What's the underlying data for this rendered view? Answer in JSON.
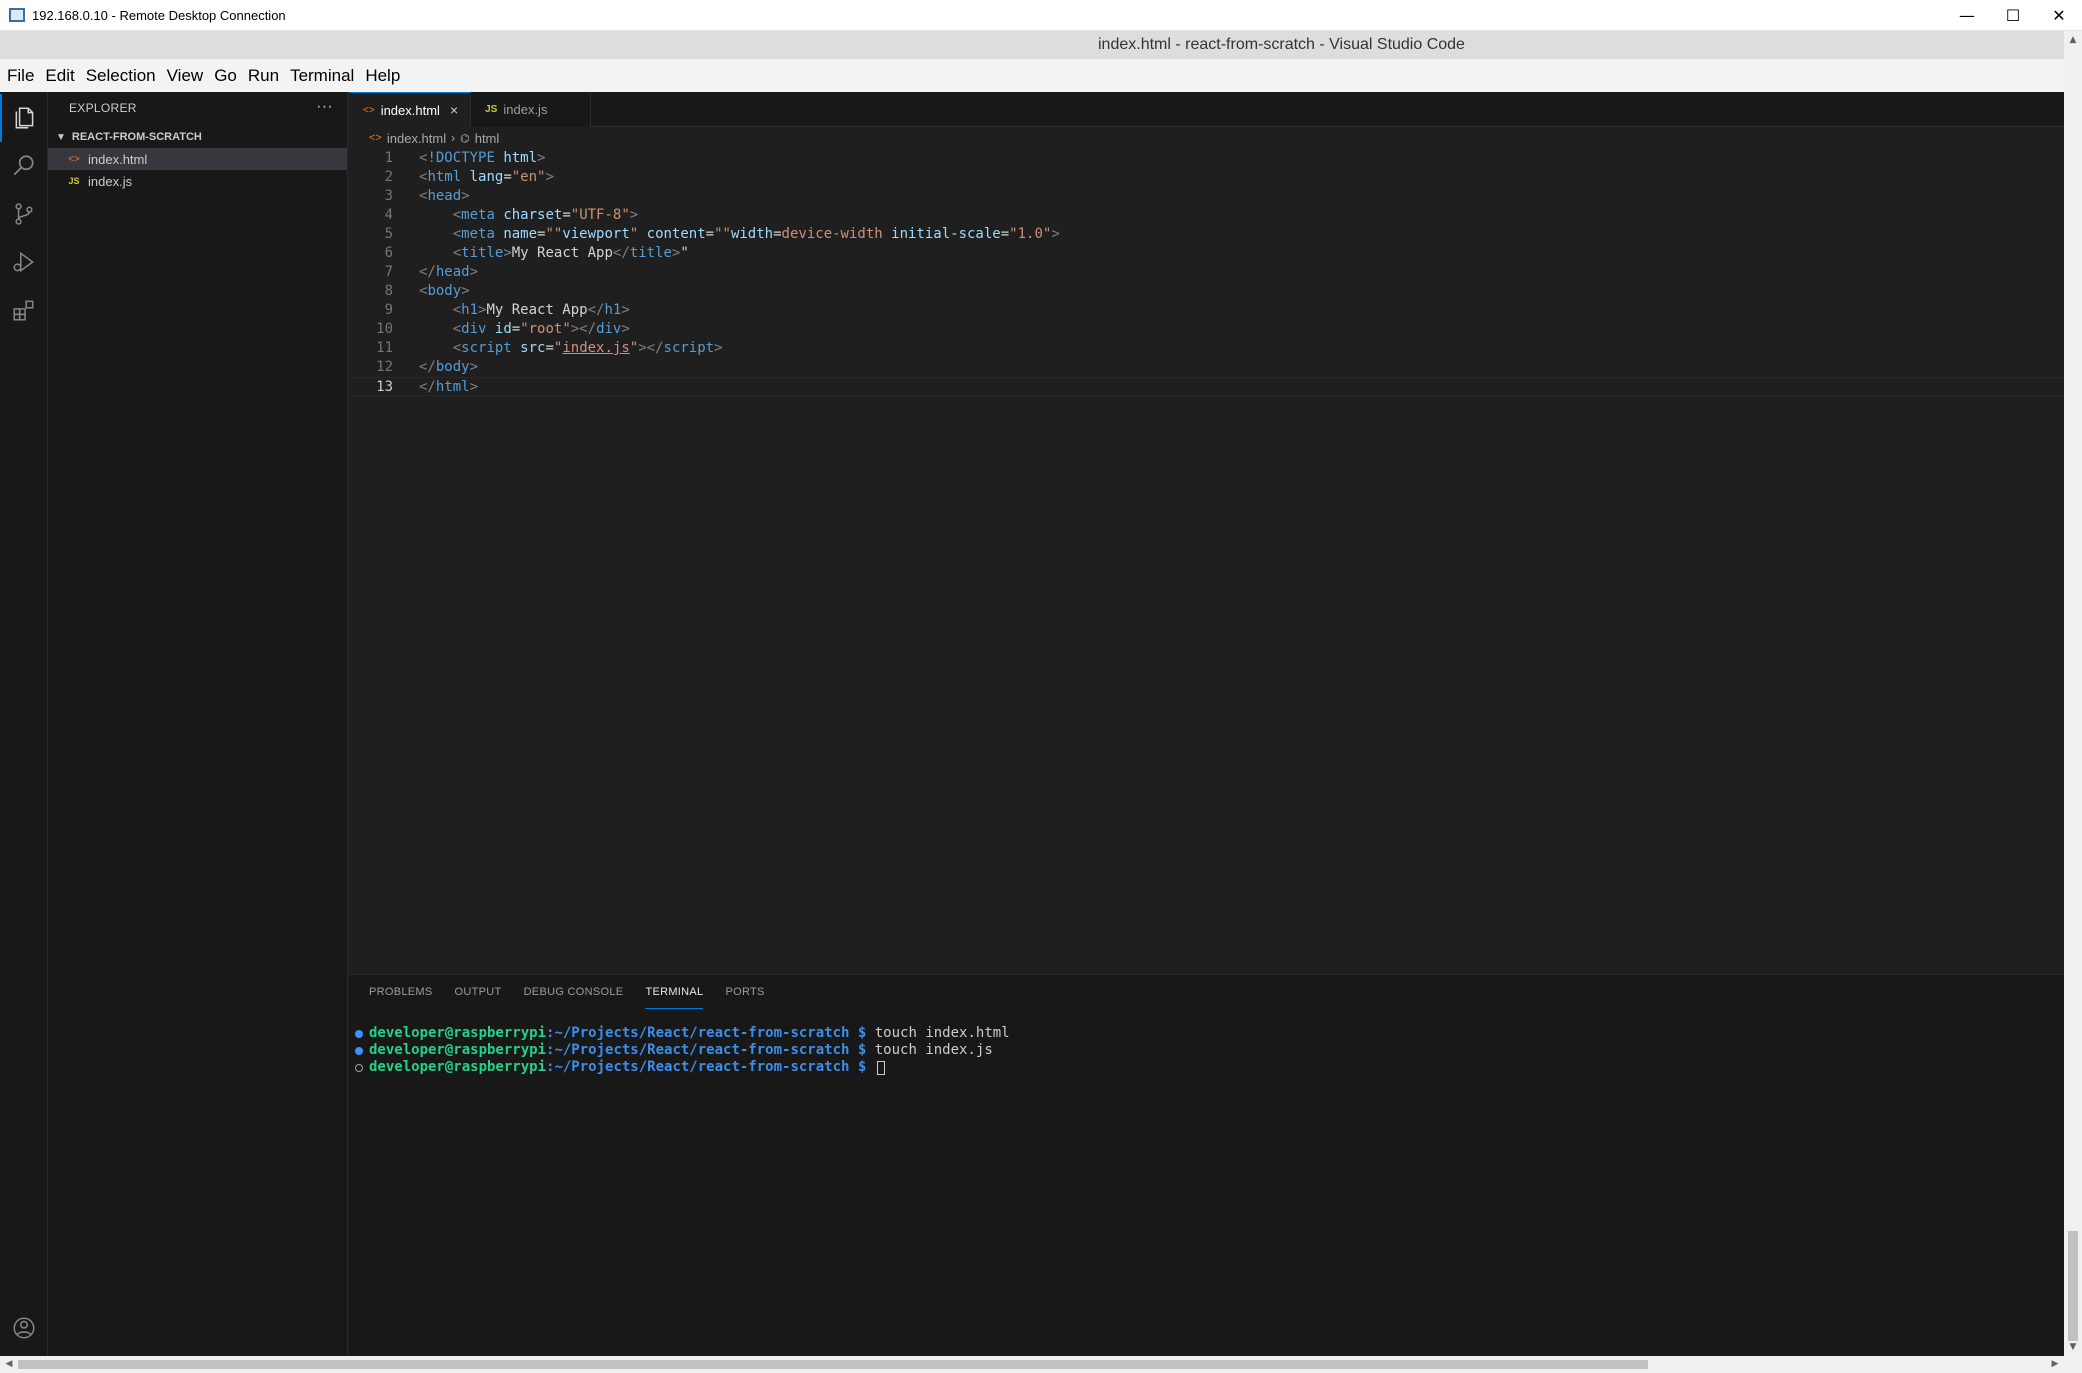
{
  "rdp": {
    "title": "192.168.0.10 - Remote Desktop Connection",
    "minimize": "—",
    "maximize": "☐",
    "close": "✕"
  },
  "vscode": {
    "title": "index.html - react-from-scratch - Visual Studio Code",
    "menu": [
      "File",
      "Edit",
      "Selection",
      "View",
      "Go",
      "Run",
      "Terminal",
      "Help"
    ]
  },
  "activity_bar": {
    "icons": [
      "files-icon",
      "search-icon",
      "source-control-icon",
      "run-debug-icon",
      "extensions-icon",
      "account-icon"
    ]
  },
  "explorer": {
    "header": "EXPLORER",
    "more": "···",
    "folder": "REACT-FROM-SCRATCH",
    "files": [
      {
        "icon": "<>",
        "name": "index.html",
        "selected": true
      },
      {
        "icon": "JS",
        "name": "index.js",
        "selected": false
      }
    ]
  },
  "tabs": [
    {
      "icon": "<>",
      "label": "index.html",
      "active": true,
      "close": "×"
    },
    {
      "icon": "JS",
      "label": "index.js",
      "active": false
    }
  ],
  "breadcrumb": {
    "file_icon": "<>",
    "file": "index.html",
    "sep": "›",
    "symbol_icon": "⌬",
    "symbol": "html"
  },
  "editor": {
    "current_line": 13,
    "lines": [
      {
        "n": "1",
        "tokens": [
          [
            "brk",
            "<"
          ],
          [
            "tag",
            "!DOCTYPE"
          ],
          [
            "txt",
            " "
          ],
          [
            "attr",
            "html"
          ],
          [
            "brk",
            ">"
          ]
        ]
      },
      {
        "n": "2",
        "tokens": [
          [
            "brk",
            "<"
          ],
          [
            "tag",
            "html"
          ],
          [
            "txt",
            " "
          ],
          [
            "attr",
            "lang"
          ],
          [
            "txt",
            "="
          ],
          [
            "str",
            "\"en\""
          ],
          [
            "brk",
            ">"
          ]
        ]
      },
      {
        "n": "3",
        "tokens": [
          [
            "brk",
            "<"
          ],
          [
            "tag",
            "head"
          ],
          [
            "brk",
            ">"
          ]
        ]
      },
      {
        "n": "4",
        "tokens": [
          [
            "txt",
            "    "
          ],
          [
            "brk",
            "<"
          ],
          [
            "tag",
            "meta"
          ],
          [
            "txt",
            " "
          ],
          [
            "attr",
            "charset"
          ],
          [
            "txt",
            "="
          ],
          [
            "str",
            "\"UTF-8\""
          ],
          [
            "brk",
            ">"
          ]
        ]
      },
      {
        "n": "5",
        "tokens": [
          [
            "txt",
            "    "
          ],
          [
            "brk",
            "<"
          ],
          [
            "tag",
            "meta"
          ],
          [
            "txt",
            " "
          ],
          [
            "attr",
            "name"
          ],
          [
            "txt",
            "="
          ],
          [
            "str",
            "\"\""
          ],
          [
            "attr",
            "viewport"
          ],
          [
            "str",
            "\""
          ],
          [
            "txt",
            " "
          ],
          [
            "attr",
            "content"
          ],
          [
            "txt",
            "="
          ],
          [
            "str",
            "\"\""
          ],
          [
            "attr",
            "width"
          ],
          [
            "txt",
            "="
          ],
          [
            "str",
            "device-width"
          ],
          [
            "txt",
            " "
          ],
          [
            "attr",
            "initial-scale"
          ],
          [
            "txt",
            "="
          ],
          [
            "str",
            "\"1.0\""
          ],
          [
            "brk",
            ">"
          ]
        ]
      },
      {
        "n": "6",
        "tokens": [
          [
            "txt",
            "    "
          ],
          [
            "brk",
            "<"
          ],
          [
            "tag",
            "title"
          ],
          [
            "brk",
            ">"
          ],
          [
            "txt",
            "My React App"
          ],
          [
            "brk",
            "</"
          ],
          [
            "tag",
            "title"
          ],
          [
            "brk",
            ">"
          ],
          [
            "txt",
            "\""
          ]
        ]
      },
      {
        "n": "7",
        "tokens": [
          [
            "brk",
            "</"
          ],
          [
            "tag",
            "head"
          ],
          [
            "brk",
            ">"
          ]
        ]
      },
      {
        "n": "8",
        "tokens": [
          [
            "brk",
            "<"
          ],
          [
            "tag",
            "body"
          ],
          [
            "brk",
            ">"
          ]
        ]
      },
      {
        "n": "9",
        "tokens": [
          [
            "txt",
            "    "
          ],
          [
            "brk",
            "<"
          ],
          [
            "tag",
            "h1"
          ],
          [
            "brk",
            ">"
          ],
          [
            "txt",
            "My React App"
          ],
          [
            "brk",
            "</"
          ],
          [
            "tag",
            "h1"
          ],
          [
            "brk",
            ">"
          ]
        ]
      },
      {
        "n": "10",
        "tokens": [
          [
            "txt",
            "    "
          ],
          [
            "brk",
            "<"
          ],
          [
            "tag",
            "div"
          ],
          [
            "txt",
            " "
          ],
          [
            "attr",
            "id"
          ],
          [
            "txt",
            "="
          ],
          [
            "str",
            "\"root\""
          ],
          [
            "brk",
            "></"
          ],
          [
            "tag",
            "div"
          ],
          [
            "brk",
            ">"
          ]
        ]
      },
      {
        "n": "11",
        "tokens": [
          [
            "txt",
            "    "
          ],
          [
            "brk",
            "<"
          ],
          [
            "tag",
            "script"
          ],
          [
            "txt",
            " "
          ],
          [
            "attr",
            "src"
          ],
          [
            "txt",
            "="
          ],
          [
            "str",
            "\""
          ],
          [
            "link",
            "index.js"
          ],
          [
            "str",
            "\""
          ],
          [
            "brk",
            "></"
          ],
          [
            "tag",
            "script"
          ],
          [
            "brk",
            ">"
          ]
        ]
      },
      {
        "n": "12",
        "tokens": [
          [
            "brk",
            "</"
          ],
          [
            "tag",
            "body"
          ],
          [
            "brk",
            ">"
          ]
        ]
      },
      {
        "n": "13",
        "tokens": [
          [
            "brk",
            "</"
          ],
          [
            "tag",
            "html"
          ],
          [
            "brk",
            ">"
          ]
        ]
      }
    ]
  },
  "panel": {
    "tabs": [
      {
        "label": "PROBLEMS",
        "active": false
      },
      {
        "label": "OUTPUT",
        "active": false
      },
      {
        "label": "DEBUG CONSOLE",
        "active": false
      },
      {
        "label": "TERMINAL",
        "active": true
      },
      {
        "label": "PORTS",
        "active": false
      }
    ],
    "terminal": [
      {
        "status": "ok",
        "user": "developer@raspberrypi",
        "path": ":~/Projects/React/react-from-scratch $",
        "cmd": " touch index.html"
      },
      {
        "status": "ok",
        "user": "developer@raspberrypi",
        "path": ":~/Projects/React/react-from-scratch $",
        "cmd": " touch index.js"
      },
      {
        "status": "empty",
        "user": "developer@raspberrypi",
        "path": ":~/Projects/React/react-from-scratch $",
        "cmd": " "
      }
    ]
  },
  "colors": {
    "accent": "#0078d4",
    "editor_bg": "#1f1f1f",
    "sidebar_bg": "#181818"
  }
}
